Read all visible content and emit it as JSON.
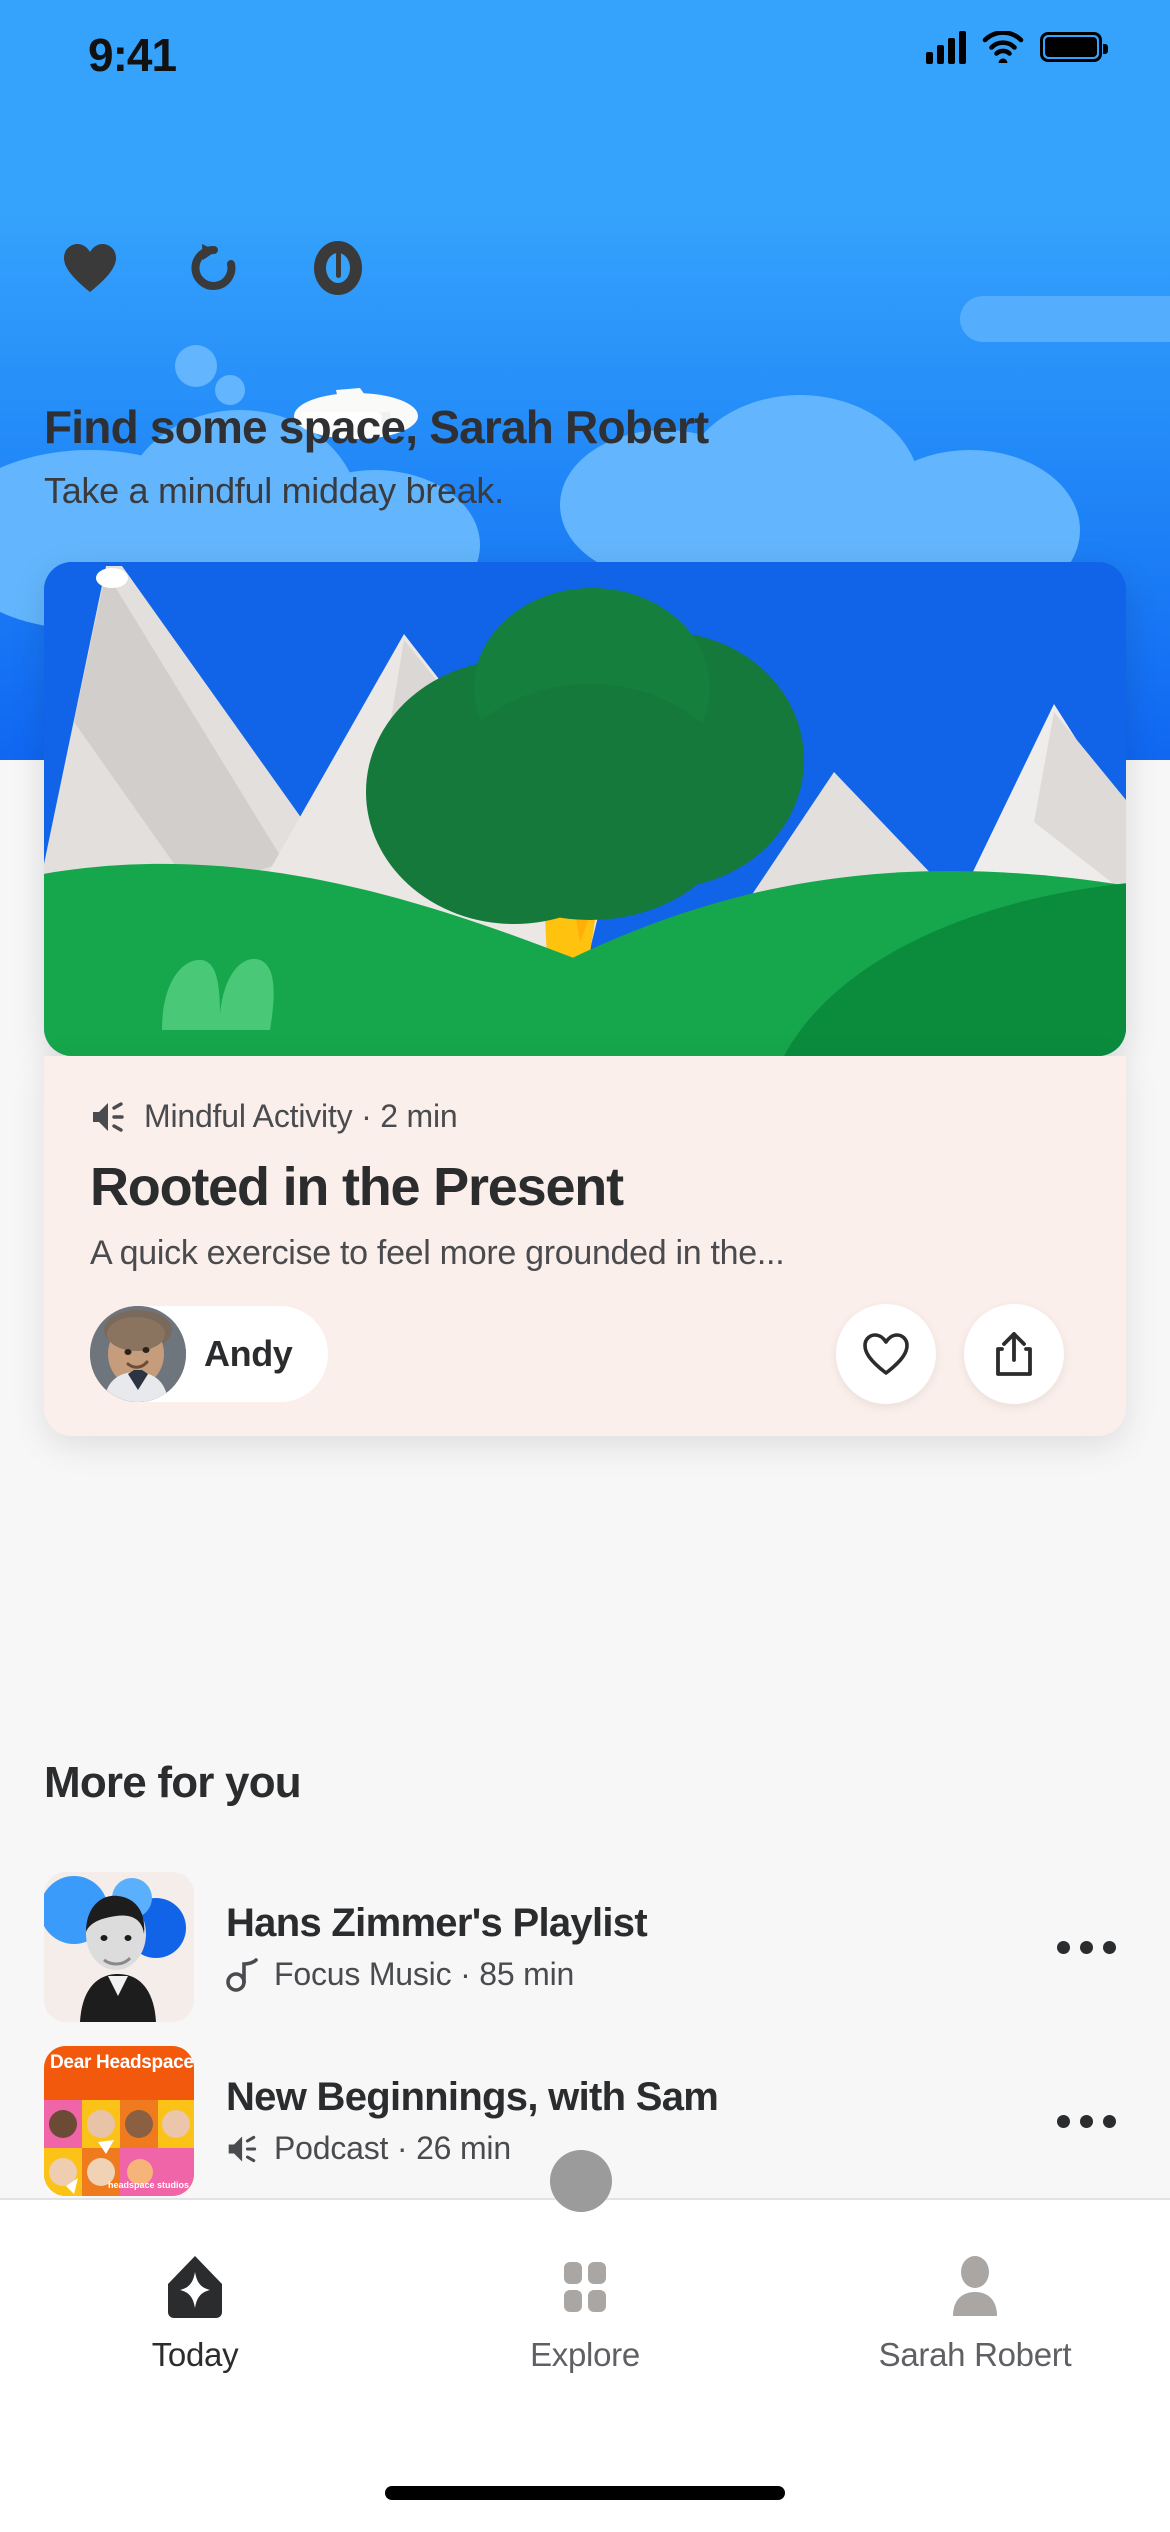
{
  "status_bar": {
    "time": "9:41",
    "cellular_icon": "signal-bars-icon",
    "wifi_icon": "wifi-icon",
    "battery_icon": "battery-icon"
  },
  "header": {
    "icons": [
      {
        "name": "favorites-heart-icon",
        "label": "Favorites"
      },
      {
        "name": "history-refresh-icon",
        "label": "History"
      },
      {
        "name": "reminders-clock-icon",
        "label": "Reminders"
      }
    ],
    "greeting": "Find some space, Sarah Robert",
    "subgreeting": "Take a mindful midday break.",
    "background_top_color": "#35A2FC",
    "background_bottom_color": "#1067F2"
  },
  "hero_card": {
    "background_color": "#FBEFEB",
    "media_type_icon": "speaker-sound-icon",
    "meta": "Mindful Activity · 2 min",
    "title": "Rooted in the Present",
    "description": "A quick exercise to feel more grounded in the...",
    "author": "Andy",
    "like_icon": "heart-outline-icon",
    "share_icon": "share-icon",
    "illustration": {
      "sky_color": "#1163E8",
      "mountain_color": "#E2DFDD",
      "mountain_shadow_color": "#D2CECB",
      "hill_color": "#16A64B",
      "hill_dark_color": "#0B8C3D",
      "tree_foliage_color": "#14793A",
      "tree_trunk_color": "#FFC20E",
      "bush_color": "#49C877"
    }
  },
  "more_for_you": {
    "title": "More for you",
    "items": [
      {
        "title": "Hans Zimmer's Playlist",
        "type_icon": "music-note-icon",
        "subtitle": "Focus Music · 85 min",
        "thumbnail": "hans-zimmer-portrait",
        "overflow_icon": "more-options-icon"
      },
      {
        "title": "New Beginnings, with Sam",
        "type_icon": "speaker-sound-icon",
        "subtitle": "Podcast · 26 min",
        "thumbnail": "dear-headspace-cover",
        "thumbnail_label": "Dear Headspace",
        "thumbnail_sublabel": "headspace studios",
        "overflow_icon": "more-options-icon"
      }
    ]
  },
  "tab_bar": {
    "tabs": [
      {
        "label": "Today",
        "icon": "home-sparkle-icon",
        "active": true
      },
      {
        "label": "Explore",
        "icon": "grid-icon",
        "active": false
      },
      {
        "label": "Sarah Robert",
        "icon": "person-icon",
        "active": false
      }
    ]
  }
}
